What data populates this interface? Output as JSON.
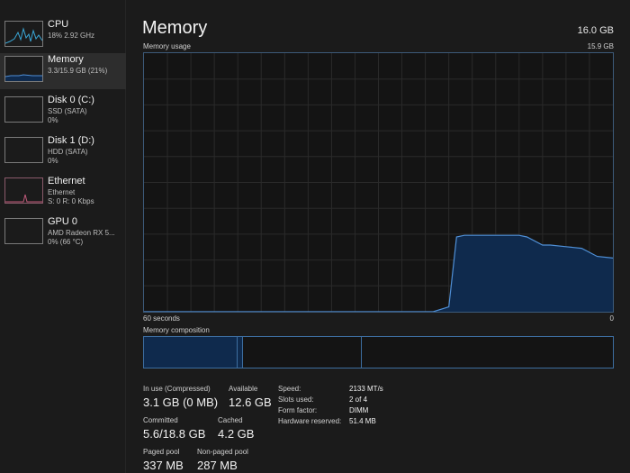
{
  "sidebar": {
    "items": [
      {
        "title": "CPU",
        "sub1": "18%  2.92 GHz",
        "sub2": "",
        "sub3": ""
      },
      {
        "title": "Memory",
        "sub1": "3.3/15.9 GB (21%)",
        "sub2": "",
        "sub3": ""
      },
      {
        "title": "Disk 0 (C:)",
        "sub1": "SSD (SATA)",
        "sub2": "0%",
        "sub3": ""
      },
      {
        "title": "Disk 1 (D:)",
        "sub1": "HDD (SATA)",
        "sub2": "0%",
        "sub3": ""
      },
      {
        "title": "Ethernet",
        "sub1": "Ethernet",
        "sub2": "S: 0  R: 0 Kbps",
        "sub3": ""
      },
      {
        "title": "GPU 0",
        "sub1": "AMD Radeon RX 5...",
        "sub2": "0%  (66 °C)",
        "sub3": ""
      }
    ]
  },
  "main": {
    "title": "Memory",
    "total": "16.0 GB",
    "usage_label": "Memory usage",
    "usage_max": "15.9 GB",
    "x_left": "60 seconds",
    "x_right": "0",
    "composition_label": "Memory composition"
  },
  "stats": {
    "in_use_label": "In use (Compressed)",
    "in_use_value": "3.1 GB (0 MB)",
    "available_label": "Available",
    "available_value": "12.6 GB",
    "committed_label": "Committed",
    "committed_value": "5.6/18.8 GB",
    "cached_label": "Cached",
    "cached_value": "4.2 GB",
    "paged_label": "Paged pool",
    "paged_value": "337 MB",
    "nonpaged_label": "Non-paged pool",
    "nonpaged_value": "287 MB"
  },
  "specs": {
    "speed_label": "Speed:",
    "speed_value": "2133 MT/s",
    "slots_label": "Slots used:",
    "slots_value": "2 of 4",
    "form_label": "Form factor:",
    "form_value": "DIMM",
    "reserved_label": "Hardware reserved:",
    "reserved_value": "51.4 MB"
  },
  "colors": {
    "memory_line": "#4f8fd6",
    "memory_fill": "#0f2a4d",
    "cpu_line": "#3aa8d8",
    "ethernet_line": "#c05a7a"
  },
  "chart_data": {
    "type": "area",
    "xlabel": "60 seconds",
    "ylabel": "Memory usage",
    "xlim": [
      60,
      0
    ],
    "ylim": [
      0,
      15.9
    ],
    "x": [
      60,
      54,
      45,
      42,
      40,
      36,
      35,
      33,
      32,
      31,
      27,
      23,
      21,
      20,
      19,
      12,
      11,
      9,
      8,
      6,
      4,
      2,
      0
    ],
    "series": [
      {
        "values": [
          0,
          0,
          0,
          0,
          0,
          0,
          0,
          0,
          0,
          0,
          0,
          0,
          0.3,
          4.6,
          4.7,
          4.7,
          4.6,
          4.1,
          4.1,
          4.0,
          3.9,
          3.4,
          3.3
        ]
      }
    ]
  }
}
